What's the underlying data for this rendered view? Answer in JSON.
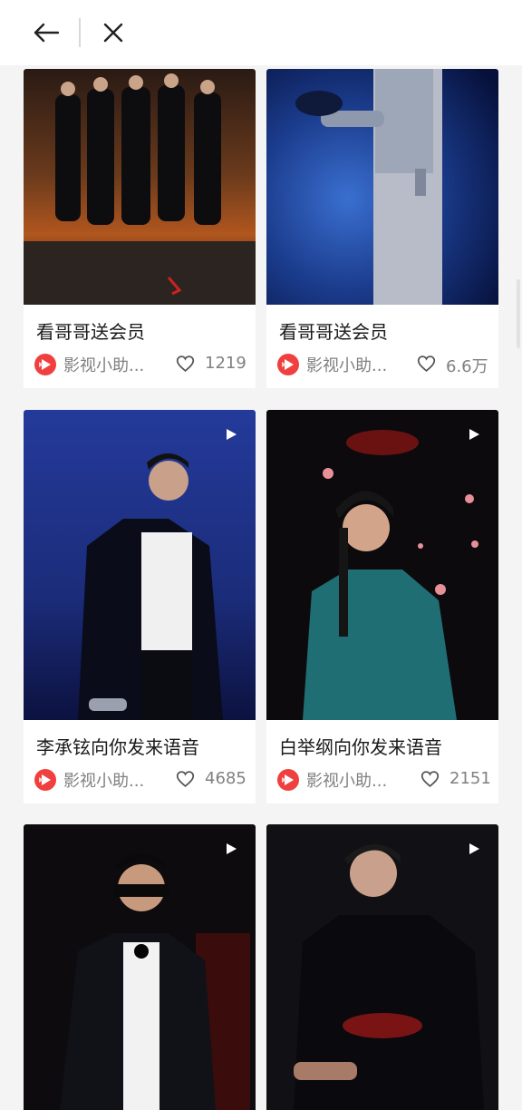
{
  "nav": {
    "back_icon": "arrow-left-icon",
    "close_icon": "close-icon"
  },
  "colors": {
    "background": "#f4f4f4",
    "card": "#ffffff",
    "title_text": "#1a1a1a",
    "meta_text": "#808080",
    "app_logo": "#f03f3f"
  },
  "feed": {
    "items": [
      {
        "title": "看哥哥送会员",
        "author": "影视小助...",
        "likes": "1219",
        "has_video": false
      },
      {
        "title": "看哥哥送会员",
        "author": "影视小助...",
        "likes": "6.6万",
        "has_video": false
      },
      {
        "title": "李承铉向你发来语音",
        "author": "影视小助...",
        "likes": "4685",
        "has_video": true
      },
      {
        "title": "白举纲向你发来语音",
        "author": "影视小助...",
        "likes": "2151",
        "has_video": true
      },
      {
        "title": "",
        "author": "",
        "likes": "",
        "has_video": true
      },
      {
        "title": "",
        "author": "",
        "likes": "",
        "has_video": true
      }
    ]
  }
}
